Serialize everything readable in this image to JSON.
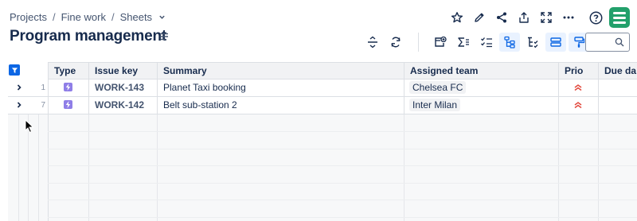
{
  "breadcrumb": {
    "items": [
      "Projects",
      "Fine work",
      "Sheets"
    ],
    "separator": "/"
  },
  "page": {
    "title": "Program management"
  },
  "top_actions": [
    "star-icon",
    "edit-icon",
    "share-icon",
    "export-icon",
    "fullscreen-icon",
    "more-icon",
    "help-icon",
    "app-logo"
  ],
  "toolbar": {
    "buttons": [
      "row-height-icon",
      "refresh-icon",
      "add-view-icon",
      "sum-icon",
      "checklist-icon",
      "hierarchy-icon",
      "tree-icon",
      "group-icon",
      "paint-icon"
    ],
    "search_placeholder": ""
  },
  "table": {
    "headers": {
      "type": "Type",
      "key": "Issue key",
      "summary": "Summary",
      "team": "Assigned team",
      "prio": "Prio",
      "due": "Due da"
    },
    "rows": [
      {
        "num": "1",
        "type": "Epic",
        "key": "WORK-143",
        "summary": "Planet Taxi booking",
        "team": "Chelsea FC",
        "prio": "high"
      },
      {
        "num": "7",
        "type": "Epic",
        "key": "WORK-142",
        "summary": "Belt sub-station 2",
        "team": "Inter Milan",
        "prio": "high"
      }
    ]
  },
  "colors": {
    "accent": "#0c66e4",
    "brand": "#22a06b",
    "epic": "#8f7ee7",
    "priority_high": "#e2483d"
  }
}
